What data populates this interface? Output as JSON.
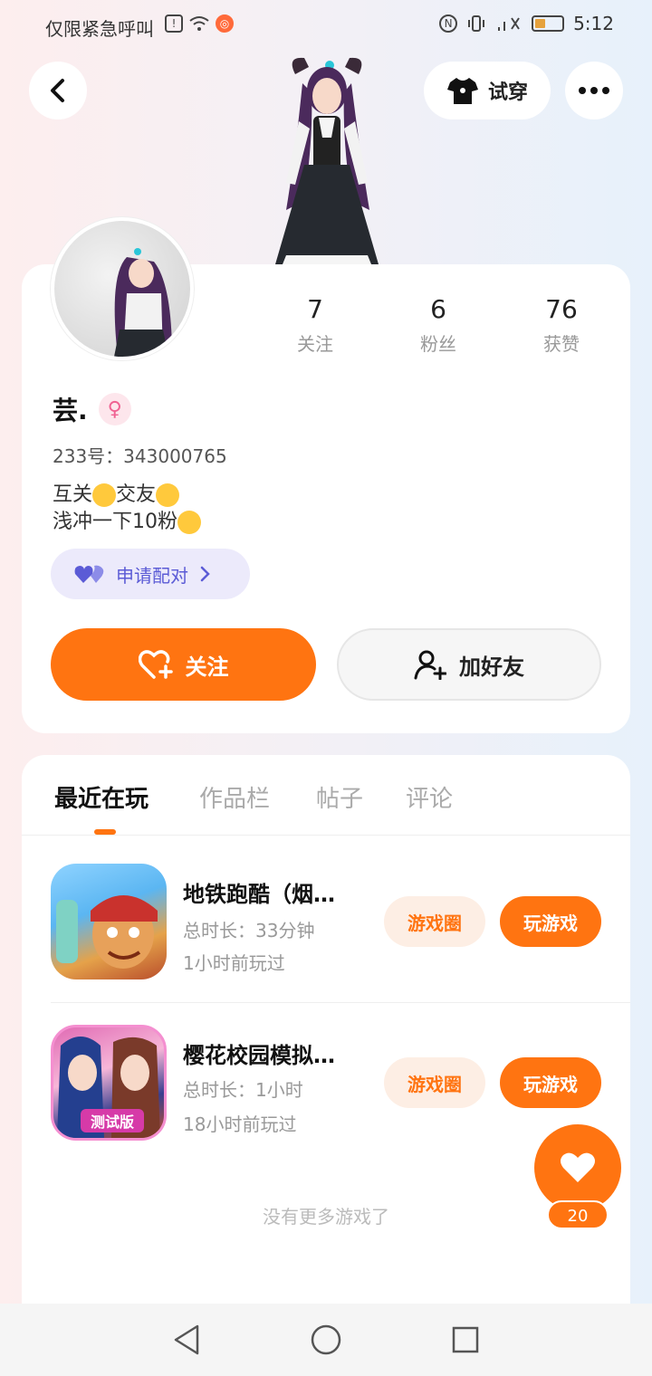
{
  "status_bar": {
    "carrier": "仅限紧急呼叫",
    "time": "5:12",
    "battery_level": 0.4
  },
  "top_bar": {
    "try_on_label": "试穿"
  },
  "profile": {
    "stats": [
      {
        "value": "7",
        "label": "关注"
      },
      {
        "value": "6",
        "label": "粉丝"
      },
      {
        "value": "76",
        "label": "获赞"
      }
    ],
    "username": "芸.",
    "gender_symbol": "♀",
    "uid": "233号：343000765",
    "bio_line1": "互关",
    "bio_line1_mid": "交友",
    "bio_line2": "浅冲一下10粉",
    "pair_label": "申请配对",
    "follow_label": "关注",
    "add_friend_label": "加好友"
  },
  "tabs": [
    "最近在玩",
    "作品栏",
    "帖子",
    "评论"
  ],
  "games": [
    {
      "title": "地铁跑酷（烟…",
      "total_time": "总时长：33分钟",
      "last_played": "1小时前玩过",
      "circle_label": "游戏圈",
      "play_label": "玩游戏"
    },
    {
      "title": "樱花校园模拟…",
      "badge": "测试版",
      "total_time": "总时长：1小时",
      "last_played": "18小时前玩过",
      "circle_label": "游戏圈",
      "play_label": "玩游戏"
    }
  ],
  "footer": {
    "no_more": "没有更多游戏了",
    "like_count": "20"
  },
  "colors": {
    "accent": "#ff7411",
    "pair_purple": "#5b5bd6"
  }
}
